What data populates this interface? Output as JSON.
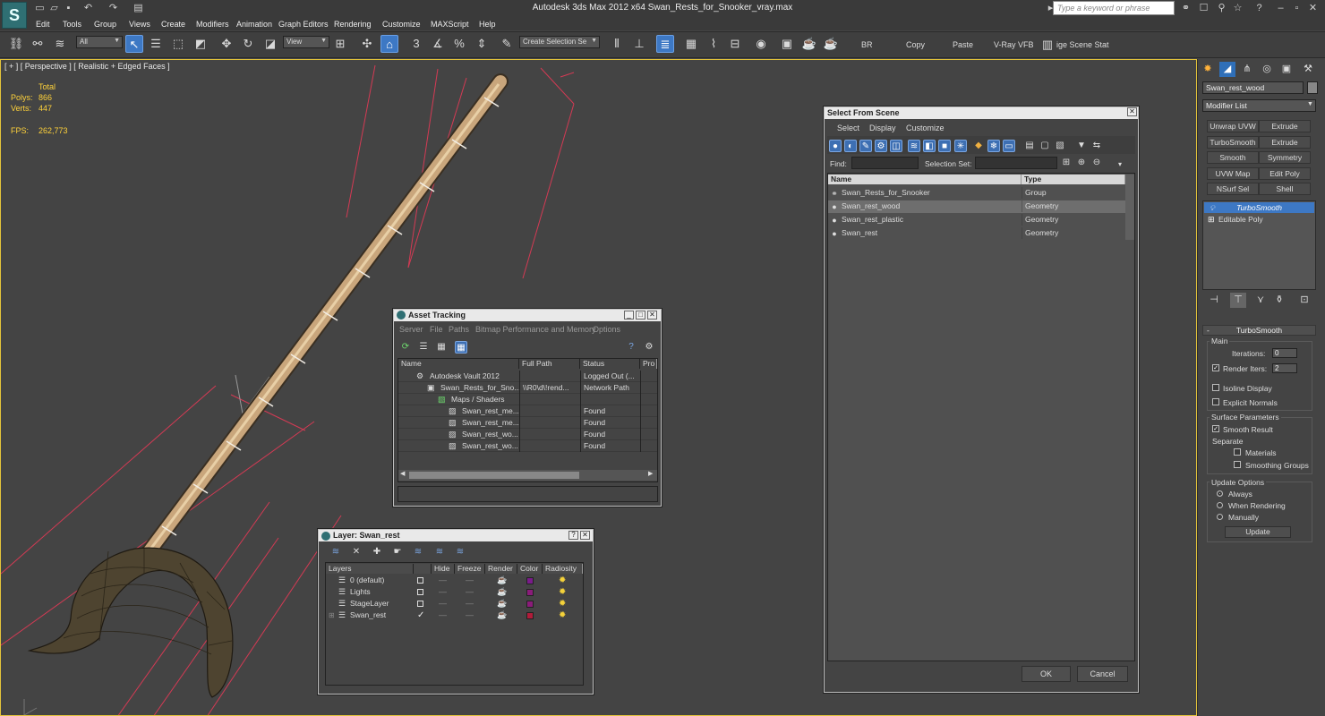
{
  "window": {
    "title": "Autodesk 3ds Max  2012 x64      Swan_Rests_for_Snooker_vray.max",
    "app_logo": "S",
    "search_placeholder": "Type a keyword or phrase"
  },
  "menu": [
    "Edit",
    "Tools",
    "Group",
    "Views",
    "Create",
    "Modifiers",
    "Animation",
    "Graph Editors",
    "Rendering",
    "Customize",
    "MAXScript",
    "Help"
  ],
  "toolbar": {
    "selection_filter": "All",
    "ref_coord": "View",
    "named_selection_placeholder": "Create Selection Se",
    "text_buttons": [
      "BR",
      "Copy",
      "Paste",
      "V-Ray VFB",
      "ige Scene Stat"
    ],
    "snaps": [
      "3",
      "%"
    ]
  },
  "viewport": {
    "label": "[ + ] [ Perspective ] [ Realistic + Edged Faces ]",
    "stats": {
      "total_label": "Total",
      "polys_label": "Polys:",
      "polys_value": "866",
      "verts_label": "Verts:",
      "verts_value": "447",
      "fps_label": "FPS:",
      "fps_value": "262,773"
    }
  },
  "command_panel": {
    "object_name": "Swan_rest_wood",
    "modifier_list": "Modifier List",
    "modifier_buttons": [
      "Unwrap UVW",
      "Extrude",
      "TurboSmooth",
      "Extrude",
      "Smooth",
      "Symmetry",
      "UVW Map",
      "Edit Poly",
      "NSurf Sel",
      "Shell"
    ],
    "stack": [
      "TurboSmooth",
      "Editable Poly"
    ],
    "rollout_title": "TurboSmooth",
    "main_group": "Main",
    "iterations_label": "Iterations:",
    "iterations_value": "0",
    "render_iters_label": "Render Iters:",
    "render_iters_value": "2",
    "isoline_display": "Isoline Display",
    "explicit_normals": "Explicit Normals",
    "surface_params": "Surface Parameters",
    "smooth_result": "Smooth Result",
    "separate": "Separate",
    "materials": "Materials",
    "smoothing_groups": "Smoothing Groups",
    "update_options": "Update Options",
    "always": "Always",
    "when_rendering": "When Rendering",
    "manually": "Manually",
    "update_button": "Update"
  },
  "select_from_scene": {
    "title": "Select From Scene",
    "menu": [
      "Select",
      "Display",
      "Customize"
    ],
    "find_label": "Find:",
    "selection_set_label": "Selection Set:",
    "columns": [
      "Name",
      "Type"
    ],
    "rows": [
      {
        "name": "Swan_Rests_for_Snooker",
        "type": "Group"
      },
      {
        "name": "Swan_rest_wood",
        "type": "Geometry"
      },
      {
        "name": "Swan_rest_plastic",
        "type": "Geometry"
      },
      {
        "name": "Swan_rest",
        "type": "Geometry"
      }
    ],
    "ok": "OK",
    "cancel": "Cancel"
  },
  "asset_tracking": {
    "title": "Asset Tracking",
    "menu": [
      "Server",
      "File",
      "Paths",
      "Bitmap Performance and Memory",
      "Options"
    ],
    "columns": [
      "Name",
      "Full Path",
      "Status",
      "Pro"
    ],
    "rows": [
      {
        "name": "Autodesk Vault 2012",
        "path": "",
        "status": "Logged Out (..."
      },
      {
        "name": "Swan_Rests_for_Sno...",
        "path": "\\\\R0\\d\\!rend...",
        "status": "Network Path"
      },
      {
        "name": "Maps / Shaders",
        "path": "",
        "status": ""
      },
      {
        "name": "Swan_rest_me...",
        "path": "",
        "status": "Found"
      },
      {
        "name": "Swan_rest_me...",
        "path": "",
        "status": "Found"
      },
      {
        "name": "Swan_rest_wo...",
        "path": "",
        "status": "Found"
      },
      {
        "name": "Swan_rest_wo...",
        "path": "",
        "status": "Found"
      }
    ]
  },
  "layer_dialog": {
    "title": "Layer: Swan_rest",
    "columns": [
      "Layers",
      "Hide",
      "Freeze",
      "Render",
      "Color",
      "Radiosity"
    ],
    "rows": [
      {
        "name": "0 (default)",
        "color": "#7a1c8a"
      },
      {
        "name": "Lights",
        "color": "#8a1c7a"
      },
      {
        "name": "StageLayer",
        "color": "#8a1c7a"
      },
      {
        "name": "Swan_rest",
        "color": "#b01c3a"
      }
    ]
  }
}
